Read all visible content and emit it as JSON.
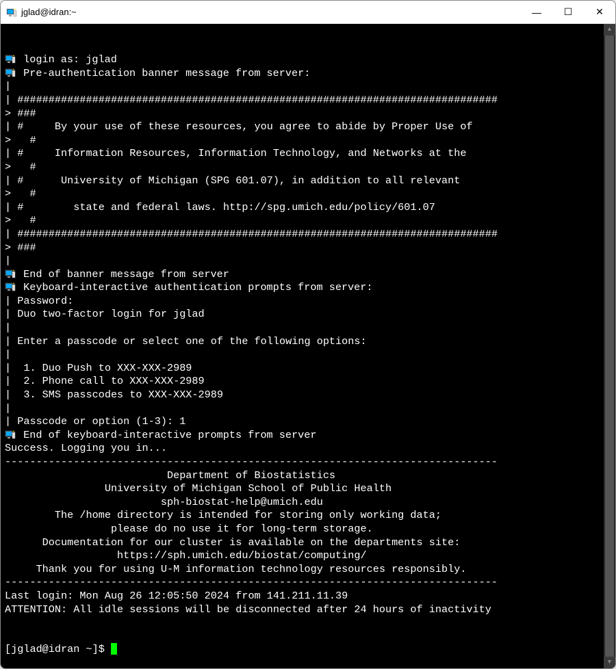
{
  "title": "jglad@idran:~",
  "lines": [
    {
      "icon": true,
      "text": " login as: jglad"
    },
    {
      "icon": true,
      "text": " Pre-authentication banner message from server:"
    },
    {
      "icon": false,
      "text": "|"
    },
    {
      "icon": false,
      "text": "| #############################################################################"
    },
    {
      "icon": false,
      "text": "> ###"
    },
    {
      "icon": false,
      "text": "| #     By your use of these resources, you agree to abide by Proper Use of"
    },
    {
      "icon": false,
      "text": ">   #"
    },
    {
      "icon": false,
      "text": "| #     Information Resources, Information Technology, and Networks at the"
    },
    {
      "icon": false,
      "text": ">   #"
    },
    {
      "icon": false,
      "text": "| #      University of Michigan (SPG 601.07), in addition to all relevant"
    },
    {
      "icon": false,
      "text": ">   #"
    },
    {
      "icon": false,
      "text": "| #        state and federal laws. http://spg.umich.edu/policy/601.07"
    },
    {
      "icon": false,
      "text": ">   #"
    },
    {
      "icon": false,
      "text": "| #############################################################################"
    },
    {
      "icon": false,
      "text": "> ###"
    },
    {
      "icon": false,
      "text": "|"
    },
    {
      "icon": true,
      "text": " End of banner message from server"
    },
    {
      "icon": true,
      "text": " Keyboard-interactive authentication prompts from server:"
    },
    {
      "icon": false,
      "text": "| Password:"
    },
    {
      "icon": false,
      "text": "| Duo two-factor login for jglad"
    },
    {
      "icon": false,
      "text": "|"
    },
    {
      "icon": false,
      "text": "| Enter a passcode or select one of the following options:"
    },
    {
      "icon": false,
      "text": "|"
    },
    {
      "icon": false,
      "text": "|  1. Duo Push to XXX-XXX-2989"
    },
    {
      "icon": false,
      "text": "|  2. Phone call to XXX-XXX-2989"
    },
    {
      "icon": false,
      "text": "|  3. SMS passcodes to XXX-XXX-2989"
    },
    {
      "icon": false,
      "text": "|"
    },
    {
      "icon": false,
      "text": "| Passcode or option (1-3): 1"
    },
    {
      "icon": true,
      "text": " End of keyboard-interactive prompts from server"
    },
    {
      "icon": false,
      "text": "Success. Logging you in..."
    },
    {
      "icon": false,
      "text": "-------------------------------------------------------------------------------"
    },
    {
      "icon": false,
      "text": "                          Department of Biostatistics"
    },
    {
      "icon": false,
      "text": "                University of Michigan School of Public Health"
    },
    {
      "icon": false,
      "text": "                         sph-biostat-help@umich.edu"
    },
    {
      "icon": false,
      "text": ""
    },
    {
      "icon": false,
      "text": "        The /home directory is intended for storing only working data;"
    },
    {
      "icon": false,
      "text": "                 please do no use it for long-term storage."
    },
    {
      "icon": false,
      "text": ""
    },
    {
      "icon": false,
      "text": "      Documentation for our cluster is available on the departments site:"
    },
    {
      "icon": false,
      "text": "                  https://sph.umich.edu/biostat/computing/"
    },
    {
      "icon": false,
      "text": ""
    },
    {
      "icon": false,
      "text": "     Thank you for using U-M information technology resources responsibly."
    },
    {
      "icon": false,
      "text": "-------------------------------------------------------------------------------"
    },
    {
      "icon": false,
      "text": "Last login: Mon Aug 26 12:05:50 2024 from 141.211.11.39"
    },
    {
      "icon": false,
      "text": "ATTENTION: All idle sessions will be disconnected after 24 hours of inactivity"
    }
  ],
  "prompt": "[jglad@idran ~]$ ",
  "controls": {
    "minimize": "—",
    "maximize": "☐",
    "close": "✕"
  }
}
